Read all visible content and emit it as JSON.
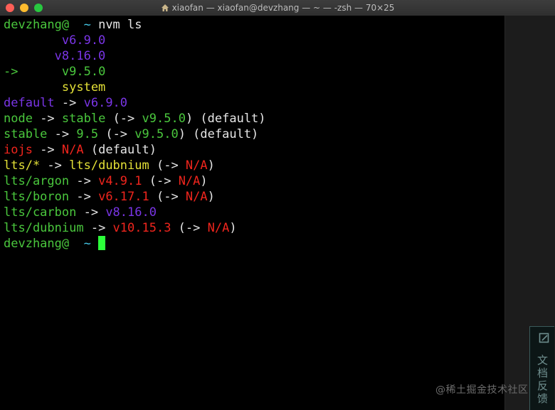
{
  "window": {
    "title": "xiaofan — xiaofan@devzhang — ~ — -zsh — 70×25"
  },
  "terminal": {
    "lines": [
      [
        {
          "t": "devzhang@",
          "c": "g"
        },
        {
          "t": "  ~ ",
          "c": "c"
        },
        {
          "t": "nvm ls",
          "c": "w"
        }
      ],
      [
        {
          "t": "        v6.9.0",
          "c": "p"
        }
      ],
      [
        {
          "t": "       v8.16.0",
          "c": "p"
        }
      ],
      [
        {
          "t": "->",
          "c": "g"
        },
        {
          "t": "      v9.5.0",
          "c": "g"
        }
      ],
      [
        {
          "t": "        system",
          "c": "y"
        }
      ],
      [
        {
          "t": "default",
          "c": "p"
        },
        {
          "t": " -> ",
          "c": "w"
        },
        {
          "t": "v6.9.0",
          "c": "p"
        }
      ],
      [
        {
          "t": "node",
          "c": "g"
        },
        {
          "t": " -> ",
          "c": "w"
        },
        {
          "t": "stable",
          "c": "g"
        },
        {
          "t": " (-> ",
          "c": "w"
        },
        {
          "t": "v9.5.0",
          "c": "g"
        },
        {
          "t": ") (default)",
          "c": "w"
        }
      ],
      [
        {
          "t": "stable",
          "c": "g"
        },
        {
          "t": " -> ",
          "c": "w"
        },
        {
          "t": "9.5",
          "c": "g"
        },
        {
          "t": " (-> ",
          "c": "w"
        },
        {
          "t": "v9.5.0",
          "c": "g"
        },
        {
          "t": ") (default)",
          "c": "w"
        }
      ],
      [
        {
          "t": "iojs",
          "c": "r"
        },
        {
          "t": " -> ",
          "c": "w"
        },
        {
          "t": "N/A",
          "c": "r"
        },
        {
          "t": " (default)",
          "c": "w"
        }
      ],
      [
        {
          "t": "lts/*",
          "c": "y"
        },
        {
          "t": " -> ",
          "c": "w"
        },
        {
          "t": "lts/dubnium",
          "c": "y"
        },
        {
          "t": " (-> ",
          "c": "w"
        },
        {
          "t": "N/A",
          "c": "r"
        },
        {
          "t": ")",
          "c": "w"
        }
      ],
      [
        {
          "t": "lts/argon",
          "c": "g"
        },
        {
          "t": " -> ",
          "c": "w"
        },
        {
          "t": "v4.9.1",
          "c": "r"
        },
        {
          "t": " (-> ",
          "c": "w"
        },
        {
          "t": "N/A",
          "c": "r"
        },
        {
          "t": ")",
          "c": "w"
        }
      ],
      [
        {
          "t": "lts/boron",
          "c": "g"
        },
        {
          "t": " -> ",
          "c": "w"
        },
        {
          "t": "v6.17.1",
          "c": "r"
        },
        {
          "t": " (-> ",
          "c": "w"
        },
        {
          "t": "N/A",
          "c": "r"
        },
        {
          "t": ")",
          "c": "w"
        }
      ],
      [
        {
          "t": "lts/carbon",
          "c": "g"
        },
        {
          "t": " -> ",
          "c": "w"
        },
        {
          "t": "v8.16.0",
          "c": "p"
        }
      ],
      [
        {
          "t": "lts/dubnium",
          "c": "g"
        },
        {
          "t": " -> ",
          "c": "w"
        },
        {
          "t": "v10.15.3",
          "c": "r"
        },
        {
          "t": " (-> ",
          "c": "w"
        },
        {
          "t": "N/A",
          "c": "r"
        },
        {
          "t": ")",
          "c": "w"
        }
      ]
    ],
    "prompt": {
      "user": "devzhang@",
      "dir": "  ~ "
    }
  },
  "side_widget": {
    "label": "文档反馈",
    "icon": "feedback-icon"
  },
  "watermark": "@稀土掘金技术社区",
  "colors": {
    "green": "#4ac73d",
    "purple": "#7a35e6",
    "yellow": "#e3e037",
    "red": "#f0251d",
    "cyan": "#44c7e6",
    "cursor": "#2cff3a"
  }
}
